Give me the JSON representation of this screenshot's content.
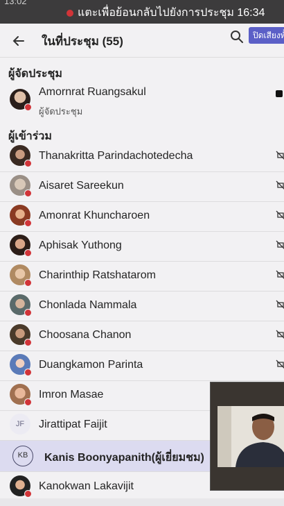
{
  "statusbar": {
    "time_left": "13:02",
    "banner": "แตะเพื่อย้อนกลับไปยังการประชุม 16:34"
  },
  "header": {
    "title": "ในที่ประชุม (55)",
    "mute_label": "ปิดเสียงทั้งหมด"
  },
  "sections": {
    "organizers": "ผู้จัดประชุม",
    "attendees": "ผู้เข้าร่วม"
  },
  "organizer": {
    "name": "Amornrat Ruangsakul",
    "role": "ผู้จัดประชุม"
  },
  "attendees": [
    {
      "name": "Thanakritta Parindachotedecha"
    },
    {
      "name": "Aisaret Sareekun"
    },
    {
      "name": "Amonrat Khuncharoen"
    },
    {
      "name": "Aphisak Yuthong"
    },
    {
      "name": "Charinthip Ratshatarom"
    },
    {
      "name": "Chonlada Nammala"
    },
    {
      "name": "Choosana Chanon"
    },
    {
      "name": "Duangkamon Parinta"
    },
    {
      "name": "Imron Masae"
    },
    {
      "name": "Jirattipat Faijit",
      "initials": "JF"
    },
    {
      "name": "Kanis Boonyapanith(ผู้เยี่ยมชม)",
      "initials": "KB"
    },
    {
      "name": "Kanokwan Lakavijit"
    }
  ],
  "colors": {
    "accent": "#5b5fc7",
    "status_busy": "#d13438",
    "highlight_row": "#dcdbf0"
  }
}
